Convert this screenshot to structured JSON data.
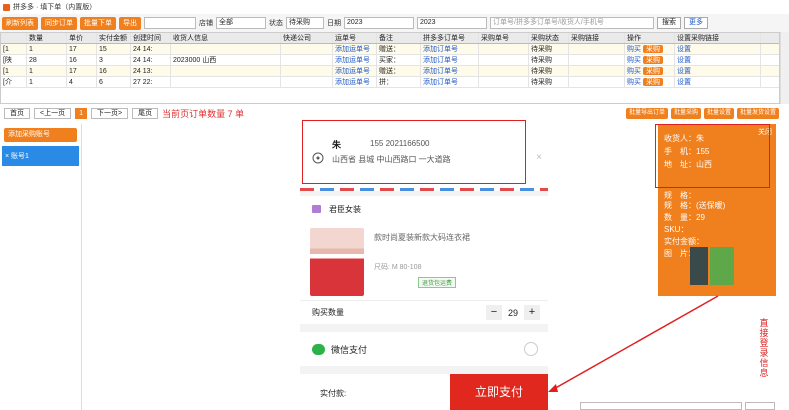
{
  "window": {
    "title": "拼多多 · 填下单（内置版）"
  },
  "toolbar": {
    "btn1": "刷新列表",
    "btn2": "同步订单",
    "btn3": "批量下单",
    "btn4": "导出",
    "label_store": "店铺",
    "store_value": "全部",
    "label_status": "状态",
    "status_value": "待采购",
    "label_date": "日期",
    "date_from": "2023",
    "date_to": "2023",
    "search_placeholder": "订单号/拼多多订单号/收货人/手机号",
    "search_btn": "搜索",
    "more_btn": "更多"
  },
  "grid": {
    "headers": [
      "",
      "数量",
      "单价",
      "实付金额",
      "创建时间",
      "收货人信息",
      "快递公司",
      "运单号",
      "备注",
      "拼多多订单号",
      "采购单号",
      "采购状态",
      "采购链接",
      "操作",
      "设置采购链接"
    ],
    "rows": [
      [
        "[1",
        "1",
        "17",
        "15",
        "24 14:",
        "",
        "",
        "添加运单号",
        "赠送：",
        "添加订单号",
        "",
        "",
        "",
        "补单",
        "设置"
      ],
      [
        "[陕",
        "28",
        "16",
        "3",
        "24 14:",
        "2023000 山西",
        "",
        "添加运单号",
        "买家：",
        "添加订单号",
        "",
        "",
        "",
        "补单",
        "设置"
      ],
      [
        "[1",
        "1",
        "17",
        "16",
        "24 13:",
        "",
        "",
        "添加运单号",
        "赠送：",
        "添加订单号",
        "",
        "",
        "",
        "补单",
        "设置"
      ],
      [
        "[介",
        "1",
        "4",
        "6",
        "27 22:",
        "",
        "",
        "添加运单号",
        "拼：",
        "添加订单号",
        "",
        "",
        "",
        "补单",
        "设置"
      ]
    ],
    "status_text": "待采购",
    "op_link": "购买",
    "op_btn": "采购"
  },
  "pager": {
    "first": "首页",
    "prev": "<上一页",
    "current": "1",
    "next": "下一页>",
    "last": "尾页",
    "count_text": "当前页订单数量 7 单"
  },
  "right_buttons": [
    "批量导出订单",
    "批量采购",
    "批量设置",
    "批量发货设置"
  ],
  "left_panel": {
    "add_label": "添加采购账号",
    "account_label": "× 账号1"
  },
  "phone": {
    "addr_name": "朱",
    "addr_phone": "155 2021166500",
    "addr_line": "山西省 县城 中山西路口 一大道路",
    "store_name": "君臣女装",
    "product_title": "款时尚夏装新款大码连衣裙",
    "product_spec": "尺码: M 80-108",
    "tag": "退货包运费",
    "qty_label": "购买数量",
    "qty_value": "29",
    "minus": "−",
    "plus": "+",
    "pay_method": "微信支付",
    "pay_label": "实付款:",
    "pay_now": "立即支付"
  },
  "info_panel": {
    "close": "关闭",
    "receiver_label": "收货人：",
    "receiver_value": "朱",
    "phone_label": "手　机：",
    "phone_value": "155",
    "addr_label": "地　址：",
    "addr_value": "山西",
    "spec_label": "规　格：",
    "spec_value": "",
    "spec2_label": "规　格：",
    "spec2_value": "(送保暖)",
    "qty_label": "数　量：",
    "qty_value": "29",
    "sku_label": "SKU：",
    "sku_value": "",
    "paid_label": "实付金额：",
    "paid_value": "",
    "img_label": "图　片："
  },
  "side_note": "直接登录信息",
  "colors": {
    "accent": "#f07f1d",
    "danger": "#e02020",
    "link": "#1e57c8"
  }
}
